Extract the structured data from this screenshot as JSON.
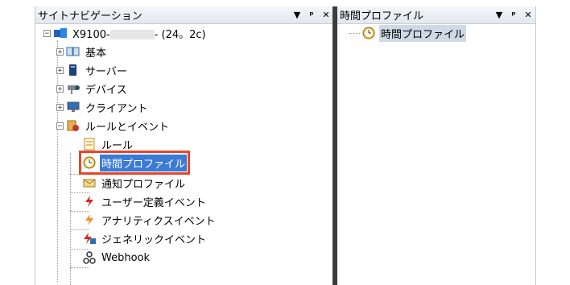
{
  "left_pane": {
    "title": "サイトナビゲーション",
    "controls": [
      "▼",
      "ᵖ",
      "✕"
    ]
  },
  "right_pane": {
    "title": "時間プロファイル",
    "controls": [
      "▼",
      "ᵖ",
      "✕"
    ],
    "items": [
      {
        "label": "時間プロファイル",
        "icon": "clock-icon"
      }
    ]
  },
  "tree": {
    "root": {
      "prefix": "X9100-",
      "suffix": "- (24。2c)",
      "icon": "server-root-icon"
    },
    "items": [
      {
        "label": "基本",
        "icon": "book-icon"
      },
      {
        "label": "サーバー",
        "icon": "server-icon"
      },
      {
        "label": "デバイス",
        "icon": "camera-icon"
      },
      {
        "label": "クライアント",
        "icon": "monitor-icon"
      },
      {
        "label": "ルールとイベント",
        "icon": "rules-icon"
      },
      {
        "label": "ルール",
        "icon": "rule-icon"
      },
      {
        "label": "時間プロファイル",
        "icon": "clock-icon"
      },
      {
        "label": "通知プロファイル",
        "icon": "mail-icon"
      },
      {
        "label": "ユーザー定義イベント",
        "icon": "lightning-icon"
      },
      {
        "label": "アナリティクスイベント",
        "icon": "lightning-chart-icon"
      },
      {
        "label": "ジェネリックイベント",
        "icon": "lightning-doc-icon"
      },
      {
        "label": "Webhook",
        "icon": "webhook-icon"
      }
    ]
  },
  "colors": {
    "accent": "#3b7bd6",
    "highlight": "#e8452c"
  }
}
